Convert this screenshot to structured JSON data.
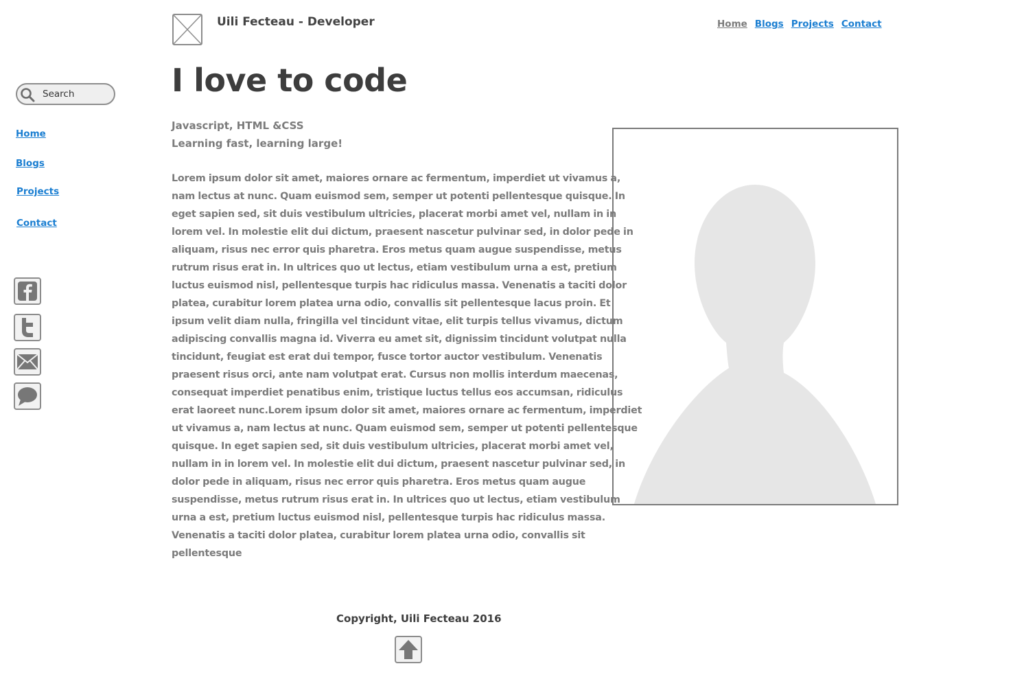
{
  "header": {
    "site_title": "Uili Fecteau - Developer",
    "nav": [
      "Home",
      "Blogs",
      "Projects",
      "Contact"
    ]
  },
  "sidebar": {
    "search_placeholder": "Search",
    "nav": [
      "Home",
      "Blogs",
      "Projects",
      "Contact"
    ],
    "social_icons": [
      "facebook-icon",
      "twitter-icon",
      "mail-icon",
      "chat-icon"
    ]
  },
  "main": {
    "heading": "I love to code",
    "subline_1": "Javascript, HTML &CSS",
    "subline_2": "Learning fast, learning large!",
    "body": "Lorem ipsum dolor sit amet, maiores ornare ac fermentum, imperdiet ut vivamus a, nam lectus at nunc. Quam euismod sem, semper ut potenti pellentesque quisque. In eget sapien sed, sit duis vestibulum ultricies, placerat morbi amet vel, nullam in in lorem vel. In molestie elit dui dictum, praesent nascetur pulvinar sed, in dolor pede in aliquam, risus nec error quis pharetra. Eros metus quam augue suspendisse, metus rutrum risus erat in.  In ultrices quo ut lectus, etiam vestibulum urna a est, pretium luctus euismod nisl, pellentesque turpis hac ridiculus massa. Venenatis a taciti dolor platea, curabitur lorem platea urna odio, convallis sit pellentesque lacus proin. Et ipsum velit diam nulla, fringilla vel tincidunt vitae, elit turpis tellus vivamus, dictum adipiscing convallis magna id. Viverra eu amet sit, dignissim tincidunt volutpat nulla tincidunt, feugiat est erat dui tempor, fusce tortor auctor vestibulum. Venenatis praesent risus orci, ante nam volutpat erat. Cursus non mollis interdum maecenas, consequat imperdiet penatibus enim, tristique luctus tellus eos accumsan, ridiculus erat laoreet nunc.Lorem ipsum dolor sit amet, maiores ornare ac fermentum, imperdiet ut vivamus a, nam lectus at nunc. Quam euismod sem, semper ut potenti pellentesque quisque. In eget sapien sed, sit duis vestibulum ultricies, placerat morbi amet vel, nullam in in lorem vel. In molestie elit dui dictum, praesent nascetur pulvinar sed, in dolor pede in aliquam, risus nec error quis pharetra. Eros metus quam augue suspendisse, metus rutrum risus erat in.  In ultrices quo ut lectus, etiam vestibulum urna a est, pretium luctus euismod nisl, pellentesque turpis hac ridiculus massa. Venenatis a taciti dolor platea, curabitur lorem platea urna odio, convallis sit pellentesque"
  },
  "footer": {
    "copyright": "Copyright, Uili Fecteau 2016"
  },
  "colors": {
    "link": "#1a7ed1",
    "text_gray": "#7b7b7b",
    "heading": "#3d3d3d",
    "border": "#8c8c8c",
    "placeholder_fill": "#e6e6e6"
  }
}
